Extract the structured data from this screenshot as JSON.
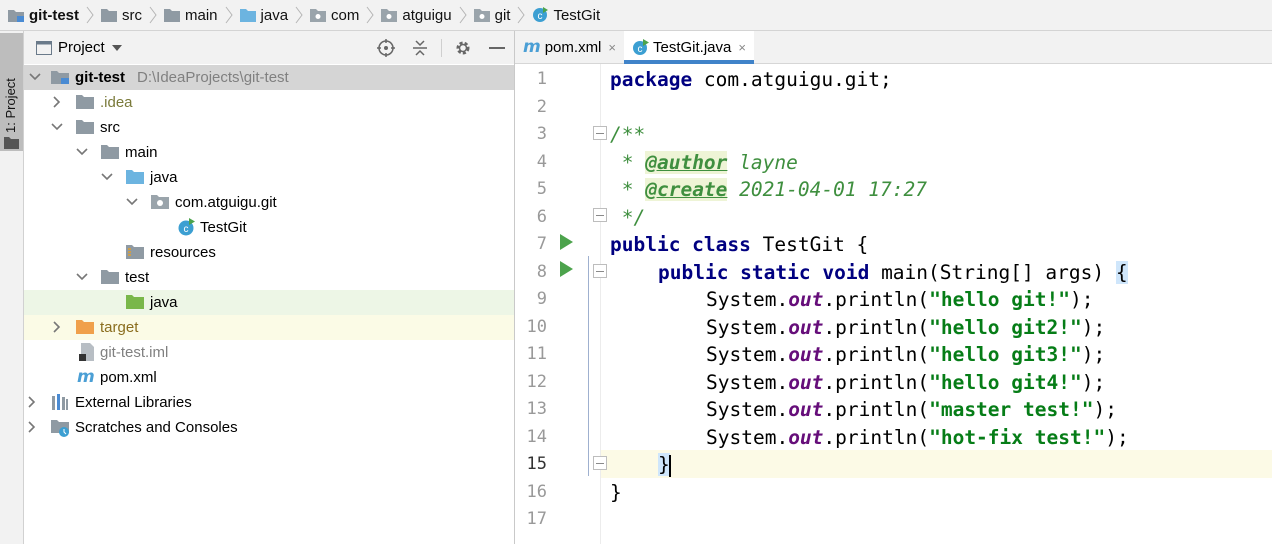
{
  "breadcrumb": [
    {
      "label": "git-test",
      "icon": "module-folder-icon"
    },
    {
      "label": "src",
      "icon": "folder-icon"
    },
    {
      "label": "main",
      "icon": "folder-icon"
    },
    {
      "label": "java",
      "icon": "source-folder-icon"
    },
    {
      "label": "com",
      "icon": "package-icon"
    },
    {
      "label": "atguigu",
      "icon": "package-icon"
    },
    {
      "label": "git",
      "icon": "package-icon"
    },
    {
      "label": "TestGit",
      "icon": "java-class-icon"
    }
  ],
  "toolstrip": {
    "project_label": "1: Project"
  },
  "project_panel": {
    "title": "Project",
    "tree": [
      {
        "label": "git-test",
        "path": "D:\\IdeaProjects\\git-test"
      },
      {
        "label": ".idea"
      },
      {
        "label": "src"
      },
      {
        "label": "main"
      },
      {
        "label": "java"
      },
      {
        "label": "com.atguigu.git"
      },
      {
        "label": "TestGit"
      },
      {
        "label": "resources"
      },
      {
        "label": "test"
      },
      {
        "label": "java"
      },
      {
        "label": "target"
      },
      {
        "label": "git-test.iml"
      },
      {
        "label": "pom.xml"
      },
      {
        "label": "External Libraries"
      },
      {
        "label": "Scratches and Consoles"
      }
    ]
  },
  "tabs": [
    {
      "label": "pom.xml",
      "close": "×"
    },
    {
      "label": "TestGit.java",
      "close": "×"
    }
  ],
  "editor": {
    "line_numbers": [
      "1",
      "2",
      "3",
      "4",
      "5",
      "6",
      "7",
      "8",
      "9",
      "10",
      "11",
      "12",
      "13",
      "14",
      "15",
      "16",
      "17"
    ],
    "code": {
      "l1_kw": "package",
      "l1_rest": " com.atguigu.git;",
      "l3": "/**",
      "l4_pre": " * ",
      "l4_tag": "@author",
      "l4_val": " layne",
      "l5_pre": " * ",
      "l5_tag": "@create",
      "l5_val": " 2021-04-01 17:27",
      "l6": " */",
      "l7_kw": "public class",
      "l7_rest": " TestGit {",
      "l8_kw": "public static void",
      "l8_rest": " main(String[] args) ",
      "l8_brace": "{",
      "sys": "System.",
      "out": "out",
      "println": ".println(",
      "s9": "\"hello git!\"",
      "s10": "\"hello git2!\"",
      "s11": "\"hello git3!\"",
      "s12": "\"hello git4!\"",
      "s13": "\"master test!\"",
      "s14": "\"hot-fix test!\"",
      "end": ");",
      "l15": "}",
      "l16": "}"
    }
  }
}
